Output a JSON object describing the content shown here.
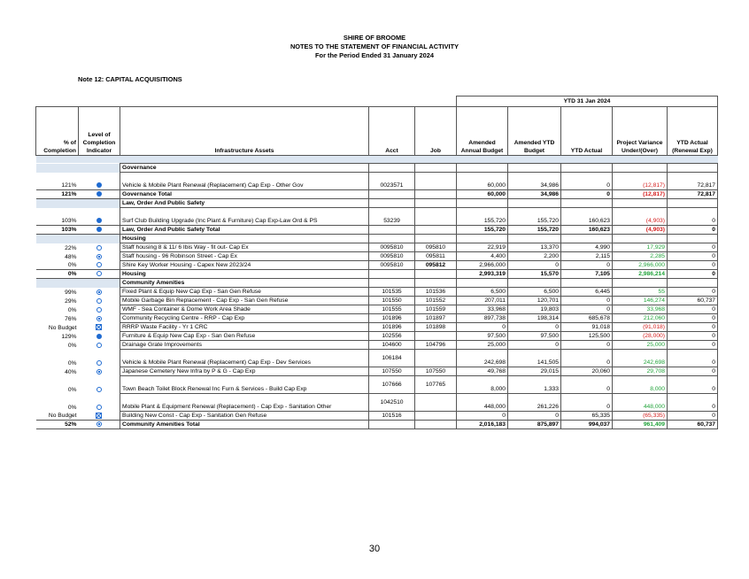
{
  "header": {
    "org": "SHIRE OF BROOME",
    "title": "NOTES TO THE STATEMENT OF FINANCIAL ACTIVITY",
    "period": "For the Period Ended 31 January 2024"
  },
  "note": "Note 12: CAPITAL ACQUISITIONS",
  "ytd_label": "YTD 31 Jan 2024",
  "columns": {
    "pct": "% of Completion",
    "level": "Level of Completion Indicator",
    "asset": "Infrastructure Assets",
    "acct": "Acct",
    "job": "Job",
    "amended_budget": "Amended Annual Budget",
    "amended_ytd": "Amended YTD Budget",
    "ytd_actual": "YTD Actual",
    "variance": "Project Variance Under/(Over)",
    "renewal": "YTD Actual (Renewal Exp)"
  },
  "indicator_icons": {
    "full": "filled-circle-icon",
    "empty": "empty-circle-icon",
    "dot": "dotted-circle-icon",
    "target": "target-circle-icon",
    "box": "boxed-x-icon"
  },
  "colors": {
    "negative": "#d42020",
    "positive": "#21a33a",
    "indicator": "#1f6bd1",
    "shade": "#dce6f1"
  },
  "rows": [
    {
      "kind": "section",
      "asset": "Governance"
    },
    {
      "kind": "item",
      "pct": "121%",
      "ind": "full",
      "asset": "Vehicle & Mobile Plant Renewal (Replacement) Cap Exp - Other  Gov",
      "acct": "0023571",
      "job": "",
      "ab": "60,000",
      "ay": "34,986",
      "ya": "0",
      "var": "(12,817)",
      "vc": "red",
      "ren": "72,817",
      "tall": true
    },
    {
      "kind": "total",
      "pct": "121%",
      "ind": "full",
      "asset": "Governance Total",
      "acct": "",
      "job": "",
      "ab": "60,000",
      "ay": "34,986",
      "ya": "0",
      "var": "(12,817)",
      "vc": "red",
      "ren": "72,817"
    },
    {
      "kind": "section",
      "asset": "Law, Order And Public Safety"
    },
    {
      "kind": "item",
      "pct": "103%",
      "ind": "full",
      "asset": "Surf Club Building Upgrade (Inc Plant & Furniture) Cap Exp-Law Ord & PS",
      "acct": "53239",
      "job": "",
      "ab": "155,720",
      "ay": "155,720",
      "ya": "160,623",
      "var": "(4,903)",
      "vc": "red",
      "ren": "0",
      "tall": true
    },
    {
      "kind": "total",
      "pct": "103%",
      "ind": "full",
      "asset": "Law, Order And Public Safety Total",
      "acct": "",
      "job": "",
      "ab": "155,720",
      "ay": "155,720",
      "ya": "160,623",
      "var": "(4,903)",
      "vc": "red",
      "ren": "0"
    },
    {
      "kind": "section",
      "asset": "Housing"
    },
    {
      "kind": "item",
      "pct": "22%",
      "ind": "empty",
      "asset": "Staff housing 8 & 11/ 6 Ibis Way - fit out- Cap Ex",
      "acct": "0095810",
      "job": "095810",
      "ab": "22,919",
      "ay": "13,370",
      "ya": "4,990",
      "var": "17,929",
      "vc": "green",
      "ren": "0"
    },
    {
      "kind": "item",
      "pct": "48%",
      "ind": "dot",
      "asset": "Staff housing - 96 Robinson Street - Cap Ex",
      "acct": "0095810",
      "job": "095811",
      "ab": "4,400",
      "ay": "2,200",
      "ya": "2,115",
      "var": "2,285",
      "vc": "green",
      "ren": "0"
    },
    {
      "kind": "item",
      "pct": "0%",
      "ind": "empty",
      "asset": "Shire Key Worker Housing - Capex New 2023/24",
      "acct": "0095810",
      "job": "095812",
      "jobbold": true,
      "ab": "2,966,000",
      "ay": "0",
      "ya": "0",
      "var": "2,966,000",
      "vc": "green",
      "ren": "0"
    },
    {
      "kind": "total",
      "pct": "0%",
      "ind": "empty",
      "asset": "Housing",
      "acct": "",
      "job": "",
      "ab": "2,993,319",
      "ay": "15,570",
      "ya": "7,105",
      "var": "2,986,214",
      "vc": "green",
      "ren": "0"
    },
    {
      "kind": "section",
      "asset": "Community Amenities"
    },
    {
      "kind": "item",
      "pct": "99%",
      "ind": "dot",
      "asset": "Fixed Plant & Equip New  Cap Exp - San Gen Refuse",
      "acct": "101535",
      "job": "101536",
      "ab": "6,500",
      "ay": "6,500",
      "ya": "6,445",
      "var": "55",
      "vc": "green",
      "ren": "0"
    },
    {
      "kind": "item",
      "pct": "29%",
      "ind": "empty",
      "asset": "Mobile Garbage Bin Replacement - Cap Exp - San Gen Refuse",
      "acct": "101550",
      "job": "101552",
      "ab": "207,011",
      "ay": "120,701",
      "ya": "0",
      "var": "146,274",
      "vc": "green",
      "ren": "60,737"
    },
    {
      "kind": "item",
      "pct": "0%",
      "ind": "empty",
      "asset": "WMF - Sea Container & Dome Work Area Shade",
      "acct": "101555",
      "job": "101559",
      "ab": "33,968",
      "ay": "19,803",
      "ya": "0",
      "var": "33,968",
      "vc": "green",
      "ren": "0"
    },
    {
      "kind": "item",
      "pct": "76%",
      "ind": "target",
      "asset": "Community Recycling Centre - RRP - Cap Exp",
      "acct": "101896",
      "job": "101897",
      "ab": "897,738",
      "ay": "198,314",
      "ya": "685,678",
      "var": "212,060",
      "vc": "green",
      "ren": "0"
    },
    {
      "kind": "item",
      "pct": "No Budget",
      "ind": "box",
      "asset": "RRRP Waste Facility - Yr 1 CRC",
      "acct": "101896",
      "job": "101898",
      "ab": "0",
      "ay": "0",
      "ya": "91,018",
      "var": "(91,018)",
      "vc": "red",
      "ren": "0"
    },
    {
      "kind": "item",
      "pct": "129%",
      "ind": "full",
      "asset": "Furniture & Equip New  Cap Exp - San Gen Refuse",
      "acct": "102556",
      "job": "",
      "ab": "97,500",
      "ay": "97,500",
      "ya": "125,500",
      "var": "(28,000)",
      "vc": "red",
      "ren": "0"
    },
    {
      "kind": "item",
      "pct": "0%",
      "ind": "empty",
      "asset": "Drainage Grate Improvements",
      "acct": "104600",
      "job": "104796",
      "ab": "25,000",
      "ay": "0",
      "ya": "0",
      "var": "25,000",
      "vc": "green",
      "ren": "0"
    },
    {
      "kind": "item",
      "pct": "0%",
      "ind": "empty",
      "asset": "Vehicle & Mobile Plant Renewal (Replacement) Cap Exp - Dev Services",
      "acct": "106184",
      "job": "",
      "ab": "242,698",
      "ay": "141,505",
      "ya": "0",
      "var": "242,698",
      "vc": "green",
      "ren": "0",
      "tall": true,
      "acctTop": true
    },
    {
      "kind": "item",
      "pct": "40%",
      "ind": "dot",
      "asset": "Japanese Cemetery New Infra by P & G - Cap Exp",
      "acct": "107550",
      "job": "107550",
      "ab": "49,768",
      "ay": "29,015",
      "ya": "20,060",
      "var": "29,708",
      "vc": "green",
      "ren": "0"
    },
    {
      "kind": "item",
      "pct": "0%",
      "ind": "empty",
      "asset": "Town Beach Toilet Block Renewal Inc Furn & Services - Build Cap Exp",
      "acct": "107666",
      "job": "107765",
      "ab": "8,000",
      "ay": "1,333",
      "ya": "0",
      "var": "8,000",
      "vc": "green",
      "ren": "0",
      "tall": true,
      "acctTop": true
    },
    {
      "kind": "item",
      "pct": "0%",
      "ind": "empty",
      "asset": "Mobile Plant & Equipment Renewal (Replacement) - Cap Exp - Sanitation Other",
      "acct": "1042510",
      "job": "",
      "ab": "448,000",
      "ay": "261,226",
      "ya": "0",
      "var": "448,000",
      "vc": "green",
      "ren": "0",
      "tall": true,
      "wrap": true,
      "acctTop": true
    },
    {
      "kind": "item",
      "pct": "No Budget",
      "ind": "box",
      "asset": "Building New  Const  - Cap Exp - Sanitation Gen Refuse",
      "acct": "101516",
      "job": "",
      "ab": "0",
      "ay": "0",
      "ya": "65,335",
      "var": "(65,335)",
      "vc": "red",
      "ren": "0"
    },
    {
      "kind": "total",
      "pct": "52%",
      "ind": "dot",
      "asset": "Community Amenities Total",
      "acct": "",
      "job": "",
      "ab": "2,016,183",
      "ay": "875,897",
      "ya": "994,037",
      "var": "961,409",
      "vc": "green",
      "ren": "60,737"
    }
  ],
  "page_number": "30"
}
